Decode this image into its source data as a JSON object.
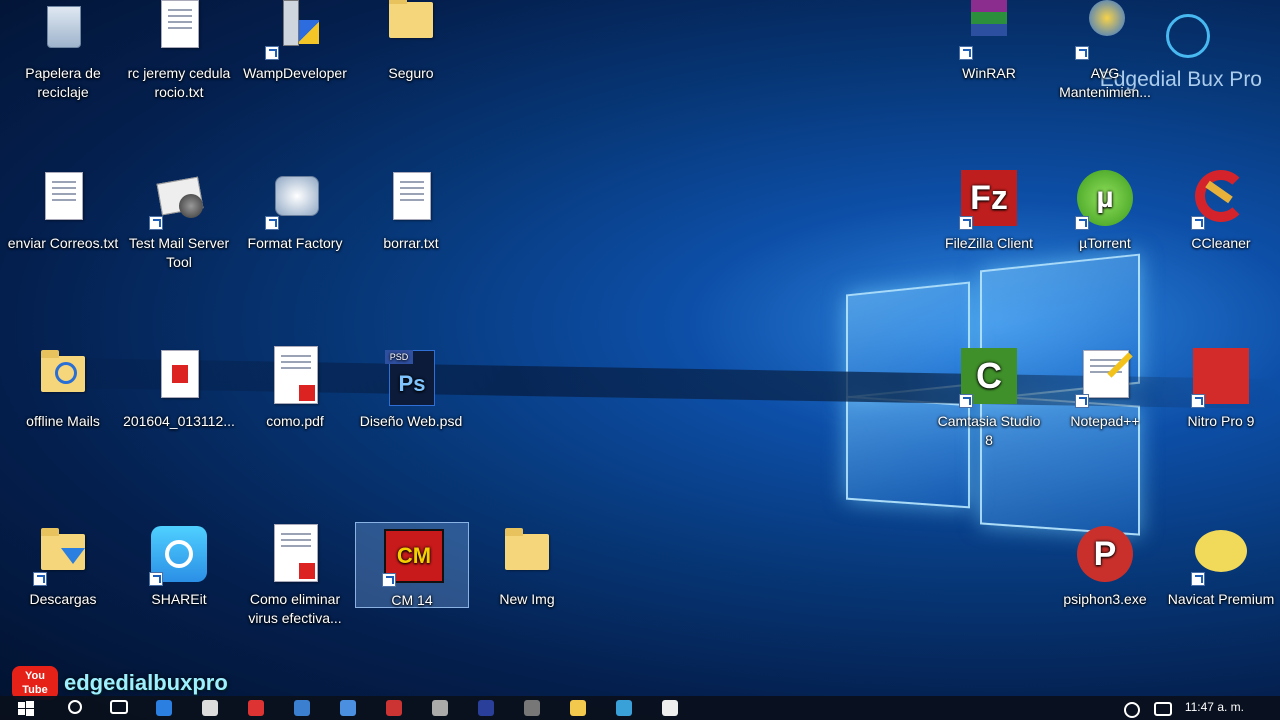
{
  "desktop": {
    "icons": [
      {
        "label": "Papelera de reciclaje",
        "icon": "recycle-bin-icon"
      },
      {
        "label": "rc jeremy cedula rocio.txt",
        "icon": "text-file-icon"
      },
      {
        "label": "WampDeveloper",
        "icon": "wampdeveloper-icon"
      },
      {
        "label": "Seguro",
        "icon": "folder-icon"
      },
      {
        "label": "WinRAR",
        "icon": "winrar-icon"
      },
      {
        "label": "AVG Mantenimien...",
        "icon": "avg-icon"
      },
      {
        "label": "enviar Correos.txt",
        "icon": "text-file-icon"
      },
      {
        "label": "Test Mail Server Tool",
        "icon": "mail-server-icon"
      },
      {
        "label": "Format Factory",
        "icon": "format-factory-icon"
      },
      {
        "label": "borrar.txt",
        "icon": "text-file-icon"
      },
      {
        "label": "FileZilla Client",
        "icon": "filezilla-icon"
      },
      {
        "label": "µTorrent",
        "icon": "utorrent-icon"
      },
      {
        "label": "CCleaner",
        "icon": "ccleaner-icon"
      },
      {
        "label": "offline Mails",
        "icon": "folder-icon"
      },
      {
        "label": "201604_013112...",
        "icon": "pdf-file-icon"
      },
      {
        "label": "como.pdf",
        "icon": "pdf-file-icon"
      },
      {
        "label": "Diseño Web.psd",
        "icon": "photoshop-icon"
      },
      {
        "label": "Camtasia Studio 8",
        "icon": "camtasia-icon"
      },
      {
        "label": "Notepad++",
        "icon": "notepad-plus-plus-icon"
      },
      {
        "label": "Nitro Pro 9",
        "icon": "nitro-pro-icon"
      },
      {
        "label": "Descargas",
        "icon": "downloads-folder-icon"
      },
      {
        "label": "SHAREit",
        "icon": "shareit-icon"
      },
      {
        "label": "Como eliminar virus efectiva...",
        "icon": "pdf-file-icon"
      },
      {
        "label": "CM 14",
        "icon": "cm14-icon"
      },
      {
        "label": "New Img",
        "icon": "folder-icon"
      },
      {
        "label": "psiphon3.exe",
        "icon": "psiphon-icon"
      },
      {
        "label": "Navicat Premium",
        "icon": "navicat-icon"
      }
    ]
  },
  "watermark": {
    "text": "Edgedial Bux Pro"
  },
  "channel": {
    "badge": "You Tube",
    "name": "edgedialbuxpro"
  },
  "taskbar": {
    "clock": "11:47 a. m."
  },
  "colors": {
    "accent": "#0d4fa8",
    "taskbar": "#0a101c"
  }
}
